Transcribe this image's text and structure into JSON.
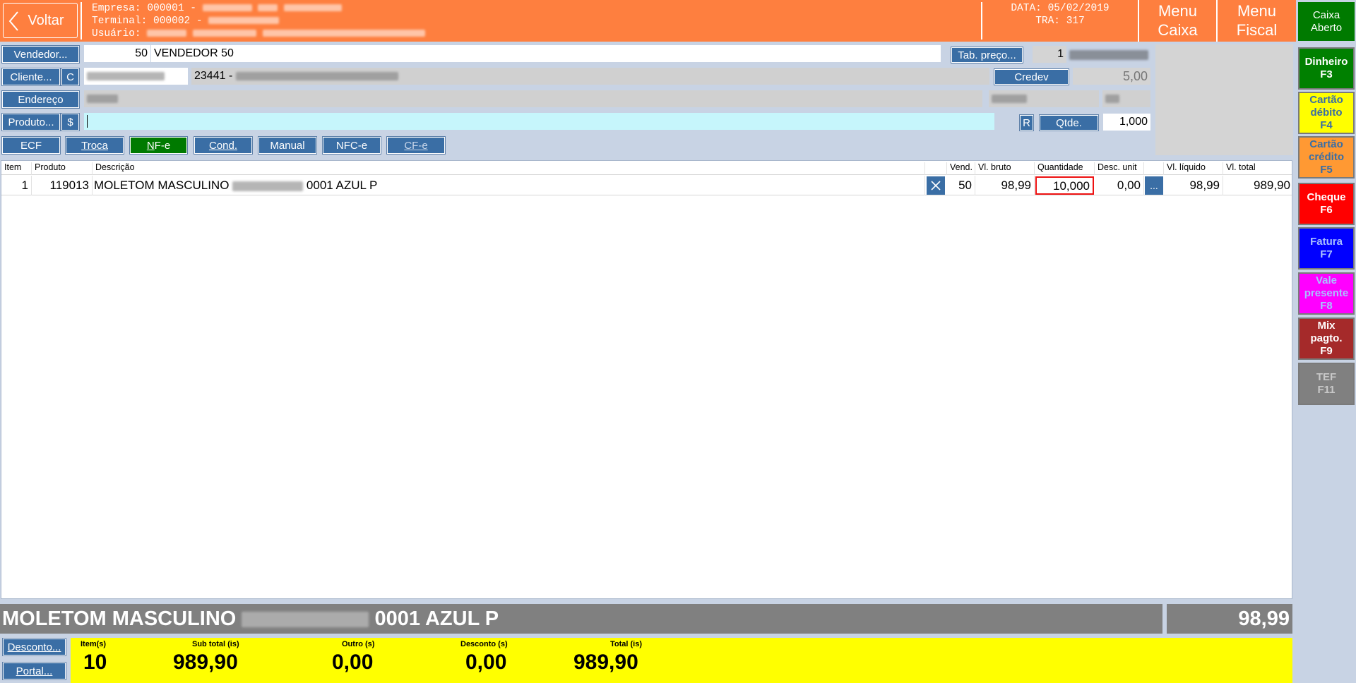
{
  "header": {
    "back_label": "Voltar",
    "empresa_label": "Empresa: 000001 -",
    "terminal_label": "Terminal: 000002 -",
    "usuario_label": "Usuário:",
    "date_label": "DATA: 05/02/2019",
    "tra_label": "TRA: 317",
    "menu_caixa": [
      "Menu",
      "Caixa"
    ],
    "menu_fiscal": [
      "Menu",
      "Fiscal"
    ]
  },
  "caixa_status": [
    "Caixa",
    "Aberto"
  ],
  "payments": [
    {
      "label": [
        "Dinheiro",
        "F3"
      ],
      "color": "#008000",
      "text": "#ffffff"
    },
    {
      "label": [
        "Cartão",
        "débito",
        "F4"
      ],
      "color": "#ffff00",
      "text": "#3a6ea5"
    },
    {
      "label": [
        "Cartão",
        "crédito",
        "F5"
      ],
      "color": "#ff9933",
      "text": "#3a6ea5"
    },
    {
      "label": [
        "Cheque",
        "F6"
      ],
      "color": "#ff0000",
      "text": "#ffffff"
    },
    {
      "label": [
        "Fatura",
        "F7"
      ],
      "color": "#0000ff",
      "text": "#a9c0ff"
    },
    {
      "label": [
        "Vale",
        "presente",
        "F8"
      ],
      "color": "#ff00ff",
      "text": "#a9c0ff"
    },
    {
      "label": [
        "Mix",
        "pagto.",
        "F9"
      ],
      "color": "#a52a2a",
      "text": "#ffffff"
    },
    {
      "label": [
        "TEF",
        "F11"
      ],
      "color": "#808080",
      "text": "#c8c8c8"
    }
  ],
  "form": {
    "vendedor_btn": "Vendedor...",
    "vendedor_code": "50",
    "vendedor_name": "VENDEDOR 50",
    "tab_preco_btn": "Tab. preço...",
    "tab_preco_value": "1",
    "cliente_btn": "Cliente...",
    "cliente_c_btn": "C",
    "cliente_name_prefix": "23441 -",
    "credev_btn": "Credev",
    "credev_value": "5,00",
    "endereco_btn": "Endereço",
    "produto_btn": "Produto...",
    "produto_dollar_btn": "$",
    "produto_value": "",
    "r_btn": "R",
    "qtde_btn": "Qtde.",
    "qtde_value": "1,000"
  },
  "tabs": [
    {
      "label": "ECF",
      "state": "normal"
    },
    {
      "label": "Troca",
      "state": "normal"
    },
    {
      "label": "NF-e",
      "state": "active"
    },
    {
      "label": "Cond.",
      "state": "normal"
    },
    {
      "label": "Manual",
      "state": "normal"
    },
    {
      "label": "NFC-e",
      "state": "normal"
    },
    {
      "label": "CF-e",
      "state": "disabled"
    }
  ],
  "grid": {
    "columns": [
      "Item",
      "Produto",
      "Descrição",
      "",
      "Vend.",
      "Vl. bruto",
      "Quantidade",
      "Desc. unit",
      "",
      "Vl. líquido",
      "Vl. total"
    ],
    "rows": [
      {
        "item": "1",
        "produto": "119013",
        "descricao_a": "MOLETOM MASCULINO",
        "descricao_b": "0001 AZUL P",
        "vend": "50",
        "vl_bruto": "98,99",
        "quantidade": "10,000",
        "desc_unit": "0,00",
        "more": "...",
        "vl_liquido": "98,99",
        "vl_total": "989,90"
      }
    ]
  },
  "current": {
    "desc_a": "MOLETOM MASCULINO",
    "desc_b": "0001 AZUL P",
    "price": "98,99"
  },
  "bottom": {
    "desconto_btn": "Desconto...",
    "portal_btn": "Portal..."
  },
  "totals": {
    "items_label": "Item(s)",
    "items_value": "10",
    "subtotal_label": "Sub total (is)",
    "subtotal_value": "989,90",
    "outro_label": "Outro (s)",
    "outro_value": "0,00",
    "desconto_label": "Desconto (s)",
    "desconto_value": "0,00",
    "total_label": "Total (is)",
    "total_value": "989,90"
  }
}
